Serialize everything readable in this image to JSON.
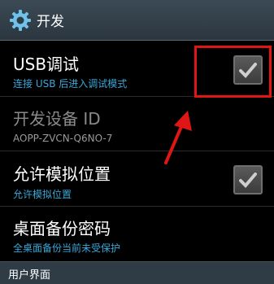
{
  "header": {
    "title": "开发",
    "icon": "gear-icon"
  },
  "items": [
    {
      "title": "USB调试",
      "subtitle": "连接 USB 后进入调试模式",
      "checked": true
    },
    {
      "title": "开发设备 ID",
      "subtitle": "AOPP-ZVCN-Q6NO-7",
      "enabled": false
    },
    {
      "title": "允许模拟位置",
      "subtitle": "允许模拟位置",
      "checked": true
    },
    {
      "title": "桌面备份密码",
      "subtitle": "全桌面备份当前未受保护"
    }
  ],
  "section_header": "用户界面",
  "colors": {
    "subtitle": "#37a8d8",
    "highlight": "#e01616",
    "header_bg": "#2f3c45"
  }
}
